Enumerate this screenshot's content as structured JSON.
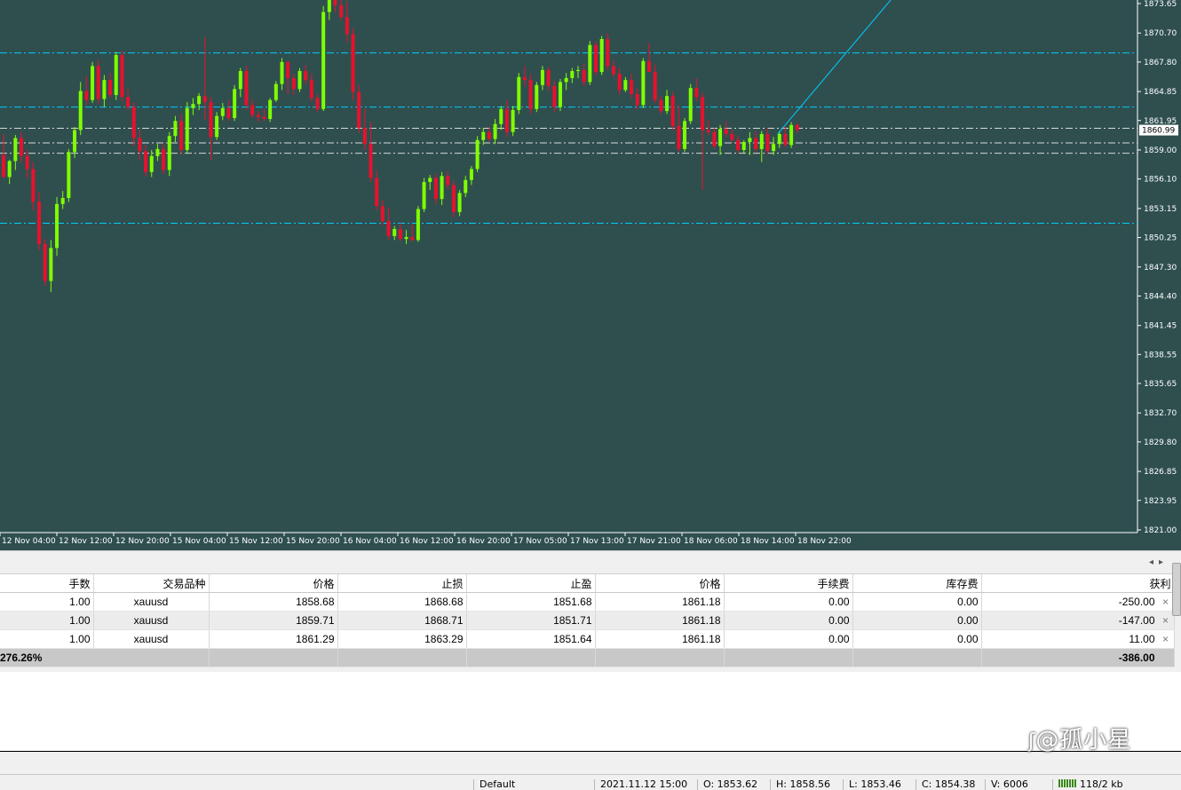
{
  "chart_data": {
    "type": "candlestick",
    "y_ticks": [
      "1873.65",
      "1870.70",
      "1867.80",
      "1864.85",
      "1861.95",
      "1859.00",
      "1856.10",
      "1853.15",
      "1850.25",
      "1847.30",
      "1844.40",
      "1841.45",
      "1838.55",
      "1835.65",
      "1832.70",
      "1829.80",
      "1826.85",
      "1823.95",
      "1821.00"
    ],
    "x_ticks": [
      "12 Nov 04:00",
      "12 Nov 12:00",
      "12 Nov 20:00",
      "15 Nov 04:00",
      "15 Nov 12:00",
      "15 Nov 20:00",
      "16 Nov 04:00",
      "16 Nov 12:00",
      "16 Nov 20:00",
      "17 Nov 05:00",
      "17 Nov 13:00",
      "17 Nov 21:00",
      "18 Nov 06:00",
      "18 Nov 14:00",
      "18 Nov 22:00"
    ],
    "current_price": "1860.99",
    "ylim": [
      1821.0,
      1873.65
    ],
    "colors": {
      "bull": "#7fff00",
      "bear": "#e8112d",
      "background": "#2f4f4f",
      "level": "#00ccff",
      "price_line": "#d8d8d8"
    },
    "levels_dashed_cyan": [
      1868.71,
      1863.29,
      1851.68
    ],
    "levels_dashdot_white": [
      1861.18,
      1859.71,
      1858.68
    ],
    "candles": [
      [
        1858.5,
        1860.6,
        1856.2,
        1856.3
      ],
      [
        1856.3,
        1858.0,
        1855.6,
        1857.9
      ],
      [
        1857.9,
        1860.5,
        1857.0,
        1860.2
      ],
      [
        1860.2,
        1860.8,
        1857.8,
        1858.4
      ],
      [
        1858.4,
        1859.0,
        1856.2,
        1857.1
      ],
      [
        1857.1,
        1857.8,
        1853.0,
        1853.8
      ],
      [
        1853.8,
        1854.8,
        1849.0,
        1849.6
      ],
      [
        1849.6,
        1850.1,
        1845.4,
        1845.9
      ],
      [
        1845.9,
        1850.0,
        1844.8,
        1849.2
      ],
      [
        1849.2,
        1854.3,
        1848.4,
        1853.6
      ],
      [
        1853.6,
        1854.9,
        1853.1,
        1854.2
      ],
      [
        1854.2,
        1859.1,
        1853.8,
        1858.8
      ],
      [
        1858.8,
        1861.3,
        1858.2,
        1861.0
      ],
      [
        1861.0,
        1865.8,
        1860.5,
        1864.9
      ],
      [
        1864.9,
        1866.4,
        1863.5,
        1864.0
      ],
      [
        1864.0,
        1867.8,
        1863.7,
        1867.4
      ],
      [
        1867.4,
        1868.0,
        1863.6,
        1864.1
      ],
      [
        1864.1,
        1866.5,
        1863.3,
        1866.0
      ],
      [
        1866.0,
        1866.7,
        1864.2,
        1864.5
      ],
      [
        1864.5,
        1868.8,
        1864.0,
        1868.5
      ],
      [
        1868.5,
        1868.9,
        1863.9,
        1864.3
      ],
      [
        1864.3,
        1865.1,
        1863.0,
        1863.3
      ],
      [
        1863.3,
        1863.8,
        1859.4,
        1860.2
      ],
      [
        1860.2,
        1861.0,
        1858.0,
        1858.9
      ],
      [
        1858.9,
        1859.5,
        1856.4,
        1856.8
      ],
      [
        1856.8,
        1859.0,
        1856.3,
        1858.4
      ],
      [
        1858.4,
        1859.6,
        1857.9,
        1859.1
      ],
      [
        1859.1,
        1859.7,
        1856.6,
        1857.0
      ],
      [
        1857.0,
        1860.8,
        1856.4,
        1860.4
      ],
      [
        1860.4,
        1862.4,
        1859.8,
        1861.9
      ],
      [
        1861.9,
        1862.6,
        1858.6,
        1859.0
      ],
      [
        1859.0,
        1863.8,
        1858.7,
        1863.2
      ],
      [
        1863.2,
        1864.2,
        1862.5,
        1863.6
      ],
      [
        1863.6,
        1864.7,
        1863.0,
        1864.4
      ],
      [
        1864.4,
        1870.3,
        1862.0,
        1863.8
      ],
      [
        1863.8,
        1864.3,
        1858.0,
        1860.3
      ],
      [
        1860.3,
        1862.8,
        1860.0,
        1862.4
      ],
      [
        1862.4,
        1863.7,
        1862.0,
        1863.2
      ],
      [
        1863.2,
        1864.0,
        1861.9,
        1862.2
      ],
      [
        1862.2,
        1865.5,
        1861.9,
        1865.1
      ],
      [
        1865.1,
        1867.2,
        1864.3,
        1866.9
      ],
      [
        1866.9,
        1867.4,
        1863.0,
        1863.5
      ],
      [
        1863.5,
        1864.0,
        1862.2,
        1862.5
      ],
      [
        1862.5,
        1862.9,
        1861.8,
        1862.3
      ],
      [
        1862.3,
        1863.1,
        1861.9,
        1862.1
      ],
      [
        1862.1,
        1864.2,
        1861.8,
        1864.0
      ],
      [
        1864.0,
        1865.9,
        1863.8,
        1865.6
      ],
      [
        1865.6,
        1868.2,
        1865.0,
        1867.8
      ],
      [
        1867.8,
        1867.9,
        1864.6,
        1866.2
      ],
      [
        1866.2,
        1866.6,
        1864.5,
        1865.1
      ],
      [
        1865.1,
        1867.2,
        1864.8,
        1866.9
      ],
      [
        1866.9,
        1867.5,
        1865.6,
        1866.0
      ],
      [
        1866.0,
        1866.6,
        1863.9,
        1864.2
      ],
      [
        1864.2,
        1864.6,
        1862.8,
        1863.1
      ],
      [
        1863.1,
        1873.4,
        1862.9,
        1872.8
      ],
      [
        1872.8,
        1875.5,
        1872.0,
        1874.6
      ],
      [
        1874.6,
        1875.4,
        1872.8,
        1873.5
      ],
      [
        1873.5,
        1874.7,
        1872.0,
        1872.3
      ],
      [
        1872.3,
        1873.9,
        1869.8,
        1870.6
      ],
      [
        1870.6,
        1871.2,
        1864.0,
        1864.8
      ],
      [
        1864.8,
        1865.5,
        1860.7,
        1861.2
      ],
      [
        1861.2,
        1863.1,
        1859.0,
        1859.6
      ],
      [
        1859.6,
        1861.8,
        1855.8,
        1856.2
      ],
      [
        1856.2,
        1856.9,
        1853.0,
        1853.4
      ],
      [
        1853.4,
        1854.0,
        1851.5,
        1851.9
      ],
      [
        1851.9,
        1853.2,
        1850.0,
        1850.4
      ],
      [
        1850.4,
        1851.4,
        1850.0,
        1851.1
      ],
      [
        1851.1,
        1851.7,
        1849.9,
        1850.1
      ],
      [
        1850.1,
        1851.0,
        1849.6,
        1850.3
      ],
      [
        1850.3,
        1851.6,
        1849.8,
        1850.0
      ],
      [
        1850.0,
        1853.4,
        1849.8,
        1853.1
      ],
      [
        1853.1,
        1856.2,
        1852.8,
        1855.8
      ],
      [
        1855.8,
        1856.5,
        1855.0,
        1856.2
      ],
      [
        1856.2,
        1856.6,
        1853.6,
        1854.1
      ],
      [
        1854.1,
        1856.8,
        1853.5,
        1856.4
      ],
      [
        1856.4,
        1856.9,
        1855.1,
        1855.5
      ],
      [
        1855.5,
        1855.9,
        1852.3,
        1852.8
      ],
      [
        1852.8,
        1855.0,
        1852.4,
        1854.7
      ],
      [
        1854.7,
        1856.4,
        1854.3,
        1856.0
      ],
      [
        1856.0,
        1857.4,
        1855.5,
        1857.1
      ],
      [
        1857.1,
        1860.4,
        1856.8,
        1860.0
      ],
      [
        1860.0,
        1861.2,
        1859.5,
        1860.8
      ],
      [
        1860.8,
        1861.3,
        1859.9,
        1860.1
      ],
      [
        1860.1,
        1862.1,
        1859.6,
        1861.6
      ],
      [
        1861.6,
        1863.4,
        1861.0,
        1863.1
      ],
      [
        1863.1,
        1864.0,
        1860.3,
        1860.8
      ],
      [
        1860.8,
        1863.4,
        1860.4,
        1863.0
      ],
      [
        1863.0,
        1866.7,
        1862.6,
        1866.3
      ],
      [
        1866.3,
        1867.4,
        1865.4,
        1866.0
      ],
      [
        1866.0,
        1866.6,
        1862.6,
        1863.1
      ],
      [
        1863.1,
        1865.8,
        1862.8,
        1865.5
      ],
      [
        1865.5,
        1867.4,
        1865.0,
        1867.0
      ],
      [
        1867.0,
        1867.3,
        1864.9,
        1865.4
      ],
      [
        1865.4,
        1865.9,
        1862.8,
        1863.3
      ],
      [
        1863.3,
        1866.1,
        1862.9,
        1865.8
      ],
      [
        1865.8,
        1866.7,
        1865.0,
        1866.2
      ],
      [
        1866.2,
        1867.2,
        1865.7,
        1866.9
      ],
      [
        1866.9,
        1867.4,
        1866.2,
        1867.0
      ],
      [
        1867.0,
        1867.6,
        1865.4,
        1865.8
      ],
      [
        1865.8,
        1869.9,
        1865.5,
        1869.5
      ],
      [
        1869.5,
        1869.9,
        1866.5,
        1866.8
      ],
      [
        1866.8,
        1870.4,
        1866.5,
        1870.1
      ],
      [
        1870.1,
        1870.7,
        1867.0,
        1867.4
      ],
      [
        1867.4,
        1867.9,
        1866.3,
        1866.6
      ],
      [
        1866.6,
        1867.2,
        1864.6,
        1865.0
      ],
      [
        1865.0,
        1866.3,
        1864.8,
        1866.0
      ],
      [
        1866.0,
        1866.6,
        1864.2,
        1864.6
      ],
      [
        1864.6,
        1865.2,
        1863.1,
        1863.5
      ],
      [
        1863.5,
        1868.2,
        1863.2,
        1867.9
      ],
      [
        1867.9,
        1869.7,
        1867.2,
        1866.8
      ],
      [
        1866.8,
        1867.5,
        1863.7,
        1864.0
      ],
      [
        1864.0,
        1864.4,
        1862.6,
        1862.9
      ],
      [
        1862.9,
        1865.0,
        1862.6,
        1864.4
      ],
      [
        1864.4,
        1864.8,
        1861.0,
        1861.4
      ],
      [
        1861.4,
        1863.4,
        1858.8,
        1859.1
      ],
      [
        1859.1,
        1862.2,
        1858.8,
        1861.9
      ],
      [
        1861.9,
        1865.6,
        1861.6,
        1865.2
      ],
      [
        1865.2,
        1866.2,
        1863.9,
        1864.3
      ],
      [
        1864.3,
        1864.7,
        1855.0,
        1861.0
      ],
      [
        1861.0,
        1862.0,
        1860.5,
        1860.8
      ],
      [
        1860.8,
        1861.2,
        1859.1,
        1859.4
      ],
      [
        1859.4,
        1861.5,
        1858.5,
        1861.1
      ],
      [
        1861.1,
        1861.9,
        1860.3,
        1860.6
      ],
      [
        1860.6,
        1861.0,
        1859.7,
        1860.0
      ],
      [
        1860.0,
        1860.4,
        1858.7,
        1859.0
      ],
      [
        1859.0,
        1860.0,
        1858.7,
        1859.8
      ],
      [
        1859.8,
        1860.8,
        1858.5,
        1860.2
      ],
      [
        1860.2,
        1860.9,
        1858.8,
        1859.1
      ],
      [
        1859.1,
        1860.9,
        1857.8,
        1860.6
      ],
      [
        1860.6,
        1861.2,
        1858.6,
        1858.9
      ],
      [
        1858.9,
        1860.3,
        1858.5,
        1859.6
      ],
      [
        1859.6,
        1860.9,
        1859.2,
        1860.6
      ],
      [
        1860.6,
        1861.3,
        1859.3,
        1859.5
      ],
      [
        1859.5,
        1861.8,
        1859.2,
        1861.5
      ],
      [
        1861.5,
        1861.7,
        1860.7,
        1860.99
      ]
    ]
  },
  "grid": {
    "headers": [
      "手数",
      "交易品种",
      "价格",
      "止损",
      "止盈",
      "价格",
      "手续费",
      "库存费",
      "获利"
    ],
    "rows": [
      [
        "1.00",
        "xauusd",
        "1858.68",
        "1868.68",
        "1851.68",
        "1861.18",
        "0.00",
        "0.00",
        "-250.00"
      ],
      [
        "1.00",
        "xauusd",
        "1859.71",
        "1868.71",
        "1851.71",
        "1861.18",
        "0.00",
        "0.00",
        "-147.00"
      ],
      [
        "1.00",
        "xauusd",
        "1861.29",
        "1863.29",
        "1851.64",
        "1861.18",
        "0.00",
        "0.00",
        "11.00"
      ]
    ],
    "close_glyph": "×",
    "total_left": "276.26%",
    "total_profit": "-386.00"
  },
  "scroll": {
    "left": "◂",
    "right": "▸"
  },
  "status": {
    "profile": "Default",
    "datetime": "2021.11.12 15:00",
    "open": "O: 1853.62",
    "high": "H: 1858.56",
    "low": "L: 1853.46",
    "close": "C: 1854.38",
    "volume": "V: 6006",
    "traffic": "118/2 kb"
  },
  "watermark": "@孤小星"
}
